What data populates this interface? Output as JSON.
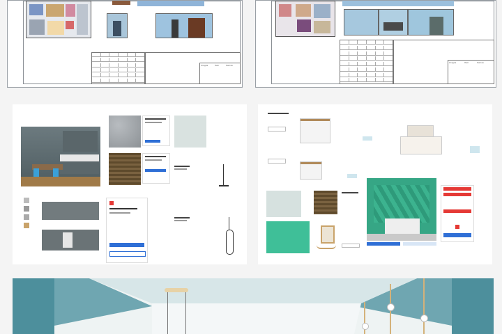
{
  "sheets": {
    "stamp_labels": [
      "Стадия",
      "Лист",
      "Листов"
    ]
  },
  "moodboard": {
    "buy_label": "Купить",
    "cart_label": "В корзину"
  },
  "colors": {
    "accent_blue": "#2f6fd6",
    "accent_red": "#e53935",
    "wall_teal": "#a9cfd2",
    "floor_wood": "#6b5a3a"
  }
}
